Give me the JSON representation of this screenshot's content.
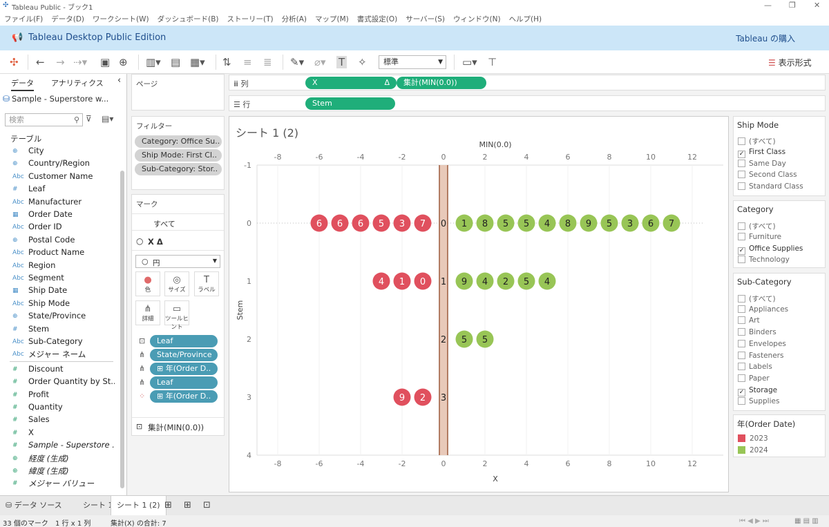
{
  "window": {
    "title": "Tableau Public - ブック1",
    "controls": [
      "—",
      "❐",
      "✕"
    ]
  },
  "menu": [
    "ファイル(F)",
    "データ(D)",
    "ワークシート(W)",
    "ダッシュボード(B)",
    "ストーリー(T)",
    "分析(A)",
    "マップ(M)",
    "書式設定(O)",
    "サーバー(S)",
    "ウィンドウ(N)",
    "ヘルプ(H)"
  ],
  "banner": {
    "edition": "Tableau Desktop Public Edition",
    "buy": "Tableau の購入"
  },
  "toolbar": {
    "format_value": "標準",
    "show_me": "表示形式"
  },
  "data_pane": {
    "tab_data": "データ",
    "tab_analytics": "アナリティクス",
    "collapse": "‹",
    "datasource": "Sample - Superstore w...",
    "search_placeholder": "検索",
    "tables_header": "テーブル",
    "dimensions": [
      {
        "icon": "globe",
        "label": "City"
      },
      {
        "icon": "globe",
        "label": "Country/Region"
      },
      {
        "icon": "abc",
        "label": "Customer Name"
      },
      {
        "icon": "hash",
        "label": "Leaf"
      },
      {
        "icon": "abc",
        "label": "Manufacturer"
      },
      {
        "icon": "date",
        "label": "Order Date"
      },
      {
        "icon": "abc",
        "label": "Order ID"
      },
      {
        "icon": "globe",
        "label": "Postal Code"
      },
      {
        "icon": "abc",
        "label": "Product Name"
      },
      {
        "icon": "abc",
        "label": "Region"
      },
      {
        "icon": "abc",
        "label": "Segment"
      },
      {
        "icon": "date",
        "label": "Ship Date"
      },
      {
        "icon": "abc",
        "label": "Ship Mode"
      },
      {
        "icon": "globe",
        "label": "State/Province"
      },
      {
        "icon": "hash",
        "label": "Stem"
      },
      {
        "icon": "abc",
        "label": "Sub-Category"
      },
      {
        "icon": "abc",
        "label": "メジャー ネーム"
      }
    ],
    "measures": [
      {
        "icon": "hash",
        "label": "Discount"
      },
      {
        "icon": "hash",
        "label": "Order Quantity by St..."
      },
      {
        "icon": "hash",
        "label": "Profit"
      },
      {
        "icon": "hash",
        "label": "Quantity"
      },
      {
        "icon": "hash",
        "label": "Sales"
      },
      {
        "icon": "hash",
        "label": "X"
      },
      {
        "icon": "hash",
        "label": "Sample - Superstore ...",
        "italic": true
      },
      {
        "icon": "globe",
        "label": "経度 (生成)",
        "italic": true
      },
      {
        "icon": "globe",
        "label": "緯度 (生成)",
        "italic": true
      },
      {
        "icon": "hash",
        "label": "メジャー バリュー",
        "italic": true
      }
    ]
  },
  "pages": {
    "title": "ページ"
  },
  "filters": {
    "title": "フィルター",
    "items": [
      "Category: Office Su..",
      "Ship Mode: First Cl..",
      "Sub-Category: Stor.."
    ]
  },
  "marks": {
    "title": "マーク",
    "all": "すべて",
    "layer": "X Δ",
    "mark_type": "円",
    "buttons": [
      {
        "label": "色",
        "icon": "●"
      },
      {
        "label": "サイズ",
        "icon": "◎"
      },
      {
        "label": "ラベル",
        "icon": "T"
      },
      {
        "label": "詳細",
        "icon": "⋔"
      },
      {
        "label": "ツールヒント",
        "icon": "▭"
      }
    ],
    "pills": [
      {
        "icon": "label-icon",
        "text": "Leaf"
      },
      {
        "icon": "detail-icon",
        "text": "State/Province"
      },
      {
        "icon": "detail-icon",
        "text": "⊞ 年(Order D.."
      },
      {
        "icon": "detail-icon",
        "text": "Leaf"
      },
      {
        "icon": "color-icon",
        "text": "⊞ 年(Order D.."
      }
    ],
    "second_layer": "集計(MIN(0.0))"
  },
  "shelves": {
    "columns_label": "列",
    "rows_label": "行",
    "columns_pills": [
      "X",
      "Δ",
      "集計(MIN(0.0))"
    ],
    "rows_pills": [
      "Stem"
    ]
  },
  "sheet": {
    "title": "シート 1 (2)"
  },
  "chart_data": {
    "type": "scatter",
    "xlabel": "X",
    "x2label": "MIN(0.0)",
    "ylabel": "Stem",
    "xlim": [
      -9,
      13.5
    ],
    "ylim": [
      -1,
      4
    ],
    "xticks": [
      -8,
      -6,
      -4,
      -2,
      0,
      2,
      4,
      6,
      8,
      10,
      12
    ],
    "yticks": [
      -1,
      0,
      1,
      2,
      3,
      4
    ],
    "center_labels": [
      0,
      1,
      2,
      3
    ],
    "series": [
      {
        "name": "2023",
        "color": "#e0505e",
        "points": [
          {
            "x": -6,
            "y": 0,
            "leaf": 6
          },
          {
            "x": -5,
            "y": 0,
            "leaf": 6
          },
          {
            "x": -4,
            "y": 0,
            "leaf": 6
          },
          {
            "x": -3,
            "y": 0,
            "leaf": 5
          },
          {
            "x": -2,
            "y": 0,
            "leaf": 3
          },
          {
            "x": -1,
            "y": 0,
            "leaf": 7
          },
          {
            "x": -3,
            "y": 1,
            "leaf": 4
          },
          {
            "x": -2,
            "y": 1,
            "leaf": 1
          },
          {
            "x": -1,
            "y": 1,
            "leaf": 0
          },
          {
            "x": -2,
            "y": 3,
            "leaf": 9
          },
          {
            "x": -1,
            "y": 3,
            "leaf": 2
          }
        ]
      },
      {
        "name": "2024",
        "color": "#98c556",
        "points": [
          {
            "x": 1,
            "y": 0,
            "leaf": 1
          },
          {
            "x": 2,
            "y": 0,
            "leaf": 8
          },
          {
            "x": 3,
            "y": 0,
            "leaf": 5
          },
          {
            "x": 4,
            "y": 0,
            "leaf": 5
          },
          {
            "x": 5,
            "y": 0,
            "leaf": 4
          },
          {
            "x": 6,
            "y": 0,
            "leaf": 8
          },
          {
            "x": 7,
            "y": 0,
            "leaf": 9
          },
          {
            "x": 8,
            "y": 0,
            "leaf": 5
          },
          {
            "x": 9,
            "y": 0,
            "leaf": 3
          },
          {
            "x": 10,
            "y": 0,
            "leaf": 6
          },
          {
            "x": 11,
            "y": 0,
            "leaf": 7
          },
          {
            "x": 1,
            "y": 1,
            "leaf": 9
          },
          {
            "x": 2,
            "y": 1,
            "leaf": 4
          },
          {
            "x": 3,
            "y": 1,
            "leaf": 2
          },
          {
            "x": 4,
            "y": 1,
            "leaf": 5
          },
          {
            "x": 5,
            "y": 1,
            "leaf": 4
          },
          {
            "x": 1,
            "y": 2,
            "leaf": 5
          },
          {
            "x": 2,
            "y": 2,
            "leaf": 5
          }
        ]
      }
    ]
  },
  "legends": {
    "ship_mode": {
      "title": "Ship Mode",
      "items": [
        {
          "label": "(すべて)",
          "checked": false
        },
        {
          "label": "First Class",
          "checked": true
        },
        {
          "label": "Same Day",
          "checked": false
        },
        {
          "label": "Second Class",
          "checked": false
        },
        {
          "label": "Standard Class",
          "checked": false
        }
      ]
    },
    "category": {
      "title": "Category",
      "items": [
        {
          "label": "(すべて)",
          "checked": false
        },
        {
          "label": "Furniture",
          "checked": false
        },
        {
          "label": "Office Supplies",
          "checked": true
        },
        {
          "label": "Technology",
          "checked": false
        }
      ]
    },
    "sub_category": {
      "title": "Sub-Category",
      "items": [
        {
          "label": "(すべて)",
          "checked": false
        },
        {
          "label": "Appliances",
          "checked": false
        },
        {
          "label": "Art",
          "checked": false
        },
        {
          "label": "Binders",
          "checked": false
        },
        {
          "label": "Envelopes",
          "checked": false
        },
        {
          "label": "Fasteners",
          "checked": false
        },
        {
          "label": "Labels",
          "checked": false
        },
        {
          "label": "Paper",
          "checked": false
        },
        {
          "label": "Storage",
          "checked": true
        },
        {
          "label": "Supplies",
          "checked": false
        }
      ]
    },
    "year": {
      "title": "年(Order Date)",
      "items": [
        {
          "label": "2023",
          "color": "#e0505e"
        },
        {
          "label": "2024",
          "color": "#98c556"
        }
      ]
    }
  },
  "tabs": {
    "datasource": "データ ソース",
    "sheets": [
      "シート 1",
      "シート 1 (2)"
    ]
  },
  "status": {
    "marks": "33 個のマーク",
    "rowscols": "1 行 x 1 列",
    "sum": "集計(X) の合計: 7"
  }
}
